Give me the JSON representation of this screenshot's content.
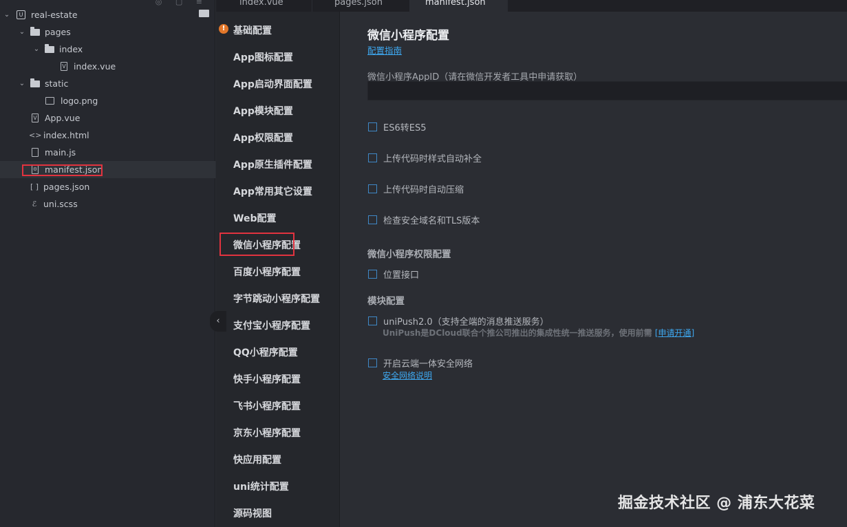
{
  "explorer": {
    "project": "real-estate",
    "items": [
      {
        "label": "pages"
      },
      {
        "label": "index"
      },
      {
        "label": "index.vue"
      },
      {
        "label": "static"
      },
      {
        "label": "logo.png"
      },
      {
        "label": "App.vue"
      },
      {
        "label": "index.html"
      },
      {
        "label": "main.js"
      },
      {
        "label": "manifest.json"
      },
      {
        "label": "pages.json"
      },
      {
        "label": "uni.scss"
      }
    ]
  },
  "tabs": [
    {
      "label": "index.vue"
    },
    {
      "label": "pages.json"
    },
    {
      "label": "manifest.json"
    }
  ],
  "nav": {
    "items": [
      {
        "label": "基础配置"
      },
      {
        "label": "App图标配置"
      },
      {
        "label": "App启动界面配置"
      },
      {
        "label": "App模块配置"
      },
      {
        "label": "App权限配置"
      },
      {
        "label": "App原生插件配置"
      },
      {
        "label": "App常用其它设置"
      },
      {
        "label": "Web配置"
      },
      {
        "label": "微信小程序配置"
      },
      {
        "label": "百度小程序配置"
      },
      {
        "label": "字节跳动小程序配置"
      },
      {
        "label": "支付宝小程序配置"
      },
      {
        "label": "QQ小程序配置"
      },
      {
        "label": "快手小程序配置"
      },
      {
        "label": "飞书小程序配置"
      },
      {
        "label": "京东小程序配置"
      },
      {
        "label": "快应用配置"
      },
      {
        "label": "uni统计配置"
      },
      {
        "label": "源码视图"
      }
    ]
  },
  "main": {
    "title": "微信小程序配置",
    "guide_link": "配置指南",
    "appid_label": "微信小程序AppID（请在微信开发者工具中申请获取）",
    "appid_value": "",
    "options": [
      {
        "label": "ES6转ES5"
      },
      {
        "label": "上传代码时样式自动补全"
      },
      {
        "label": "上传代码时自动压缩"
      },
      {
        "label": "检查安全域名和TLS版本"
      }
    ],
    "permission_section": "微信小程序权限配置",
    "location_label": "位置接口",
    "module_section": "模块配置",
    "unipush_label": "uniPush2.0（支持全端的消息推送服务）",
    "unipush_note": "UniPush是DCloud联合个推公司推出的集成性统一推送服务，使用前需",
    "unipush_link": "[申请开通]",
    "cloud_label": "开启云端一体安全网络",
    "cloud_link": "安全网络说明"
  },
  "watermark": "掘金技术社区 @ 浦东大花菜",
  "colors": {
    "accent": "#3ea8f0",
    "highlight_box": "#e2333f",
    "warning": "#e2772a"
  }
}
